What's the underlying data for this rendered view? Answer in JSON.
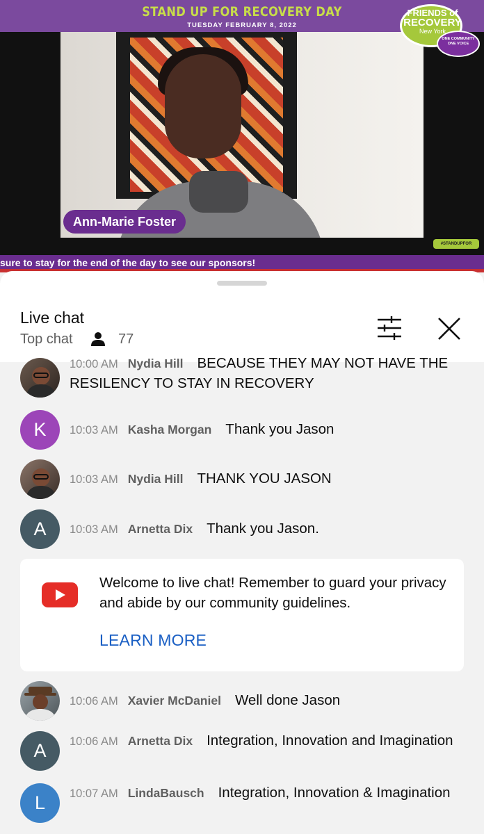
{
  "video": {
    "banner_title": "STAND UP FOR RECOVERY DAY",
    "banner_date": "TUESDAY FEBRUARY 8, 2022",
    "logo": {
      "line1": "FRIENDS of",
      "line2": "RECOVERY",
      "line3": "New York",
      "badge": "ONE COMMUNITY ONE VOICE"
    },
    "speaker_name": "Ann-Marie Foster",
    "hashtag": "#STANDUPFOR",
    "ticker": "sure to stay for the end of the day to see our sponsors!",
    "colors": {
      "banner": "#7b4a9e",
      "accent_green": "#a5c83b",
      "name_tag": "#6a2d8f"
    }
  },
  "chat": {
    "title": "Live chat",
    "mode": "Top chat",
    "viewer_count": "77",
    "messages": [
      {
        "time": "10:00 AM",
        "author": "Nydia Hill",
        "text": "BECAUSE THEY MAY NOT HAVE THE RESILENCY TO STAY IN RECOVERY",
        "avatar": "photo"
      },
      {
        "time": "10:03 AM",
        "author": "Kasha Morgan",
        "text": "Thank you Jason",
        "avatar_letter": "K",
        "avatar_color": "#9c45b8"
      },
      {
        "time": "10:03 AM",
        "author": "Nydia Hill",
        "text": "THANK YOU JASON",
        "avatar": "photo"
      },
      {
        "time": "10:03 AM",
        "author": "Arnetta Dix",
        "text": "Thank you Jason.",
        "avatar_letter": "A",
        "avatar_color": "#455a64"
      },
      {
        "time": "10:06 AM",
        "author": "Xavier McDaniel",
        "text": "Well done Jason",
        "avatar": "photo"
      },
      {
        "time": "10:06 AM",
        "author": "Arnetta Dix",
        "text": "Integration, Innovation and Imagination",
        "avatar_letter": "A",
        "avatar_color": "#455a64"
      },
      {
        "time": "10:07 AM",
        "author": "LindaBausch",
        "text": "Integration, Innovation & Imagination",
        "avatar_letter": "L",
        "avatar_color": "#3b82c8"
      }
    ],
    "welcome": {
      "text": "Welcome to live chat! Remember to guard your privacy and abide by our community guidelines.",
      "link": "LEARN MORE"
    }
  }
}
